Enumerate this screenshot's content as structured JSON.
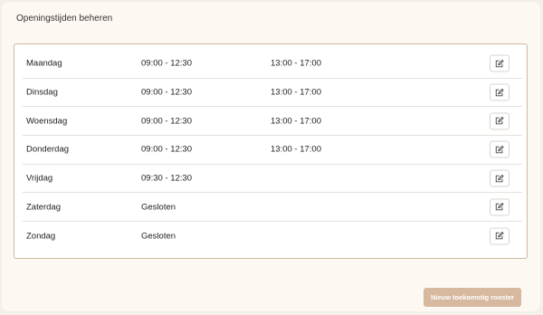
{
  "panel": {
    "title": "Openingstijden beheren"
  },
  "schedule": [
    {
      "day": "Maandag",
      "slot1": "09:00 - 12:30",
      "slot2": "13:00 - 17:00"
    },
    {
      "day": "Dinsdag",
      "slot1": "09:00 - 12:30",
      "slot2": "13:00 - 17:00"
    },
    {
      "day": "Woensdag",
      "slot1": "09:00 - 12:30",
      "slot2": "13:00 - 17:00"
    },
    {
      "day": "Donderdag",
      "slot1": "09:00 - 12:30",
      "slot2": "13:00 - 17:00"
    },
    {
      "day": "Vrijdag",
      "slot1": "09:30 - 12:30",
      "slot2": ""
    },
    {
      "day": "Zaterdag",
      "slot1": "Gesloten",
      "slot2": ""
    },
    {
      "day": "Zondag",
      "slot1": "Gesloten",
      "slot2": ""
    }
  ],
  "icons": {
    "edit": "edit-icon"
  },
  "actions": {
    "new_schedule_label": "Nieuw toekomstig rooster"
  },
  "colors": {
    "accent": "#d7b9a0",
    "card_border": "#cdb9a1",
    "panel_bg": "#fdf8f1"
  }
}
